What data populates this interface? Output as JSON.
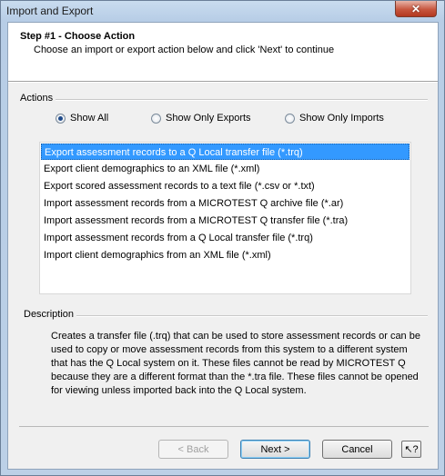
{
  "window": {
    "title": "Import and Export",
    "close_glyph": "✕"
  },
  "header": {
    "step_title": "Step #1 - Choose Action",
    "instruction": "Choose an import or export action below and click 'Next' to continue"
  },
  "actions": {
    "label": "Actions",
    "filters": [
      {
        "label": "Show All",
        "selected": true
      },
      {
        "label": "Show Only Exports",
        "selected": false
      },
      {
        "label": "Show Only Imports",
        "selected": false
      }
    ],
    "items": [
      {
        "label": "Export assessment records to a Q Local transfer file (*.trq)",
        "selected": true
      },
      {
        "label": "Export client demographics to an XML file (*.xml)",
        "selected": false
      },
      {
        "label": "Export scored assessment records to a text file (*.csv or *.txt)",
        "selected": false
      },
      {
        "label": "Import assessment records from a MICROTEST Q archive file (*.ar)",
        "selected": false
      },
      {
        "label": "Import assessment records from a MICROTEST Q transfer file (*.tra)",
        "selected": false
      },
      {
        "label": "Import assessment records from a Q Local transfer file (*.trq)",
        "selected": false
      },
      {
        "label": "Import client demographics from an XML file (*.xml)",
        "selected": false
      }
    ]
  },
  "description": {
    "label": "Description",
    "text": "Creates a transfer file (.trq) that can be used to store assessment records or can be used to copy or move assessment records from this system to a different system that has the Q Local system on it. These files cannot be read by MICROTEST Q because they are a different format than the *.tra file. These files cannot be opened for viewing unless imported back into the Q Local system."
  },
  "buttons": {
    "back": "< Back",
    "next": "Next >",
    "cancel": "Cancel",
    "help_glyph": "↖?"
  },
  "colors": {
    "selection": "#3399ff",
    "title_gradient": "#b7cde6"
  }
}
